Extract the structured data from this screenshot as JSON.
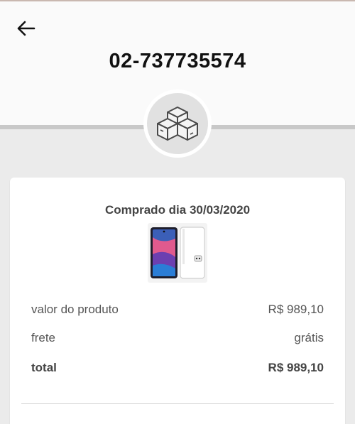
{
  "header": {
    "order_id": "02-737735574",
    "back_icon": "arrow-left-icon",
    "status_icon": "boxes-icon"
  },
  "order": {
    "purchased_label": "Comprado dia 30/03/2020",
    "product_image": "smartphone-product-image",
    "rows": [
      {
        "label": "valor do produto",
        "value": "R$ 989,10"
      },
      {
        "label": "frete",
        "value": "grátis"
      },
      {
        "label": "total",
        "value": "R$ 989,10"
      }
    ]
  },
  "colors": {
    "header_bg": "#fafafa",
    "page_bg": "#ebebeb",
    "card_bg": "#ffffff",
    "divider": "#c8c8c8"
  }
}
